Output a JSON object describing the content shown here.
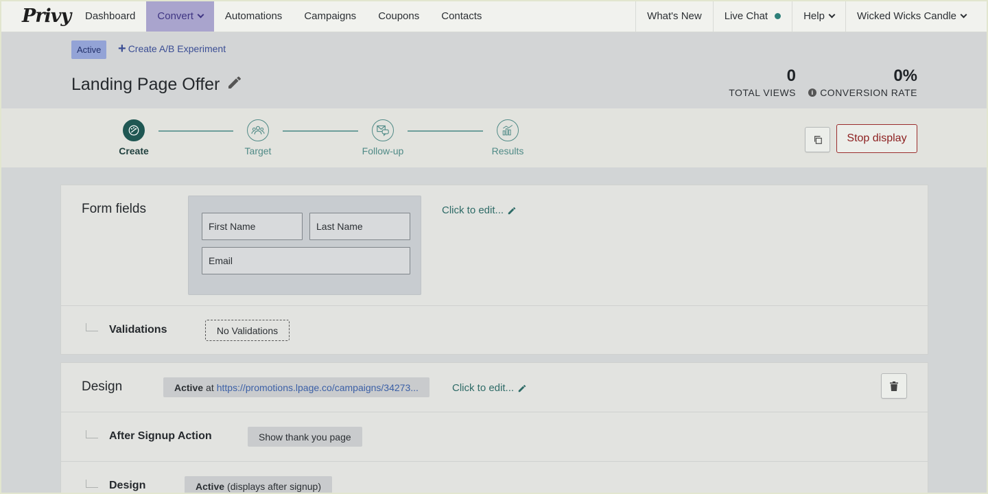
{
  "brand": {
    "logo_text": "Privy"
  },
  "nav": {
    "items": [
      {
        "label": "Dashboard"
      },
      {
        "label": "Convert"
      },
      {
        "label": "Automations"
      },
      {
        "label": "Campaigns"
      },
      {
        "label": "Coupons"
      },
      {
        "label": "Contacts"
      }
    ],
    "right": {
      "whats_new": "What's New",
      "live_chat": "Live Chat",
      "help": "Help",
      "account": "Wicked Wicks Candle"
    }
  },
  "header": {
    "status_badge": "Active",
    "ab_link": "Create A/B Experiment",
    "title": "Landing Page Offer",
    "stats": {
      "total_views": {
        "value": "0",
        "label": "TOTAL VIEWS"
      },
      "conversion_rate": {
        "value": "0%",
        "label": "CONVERSION RATE"
      }
    }
  },
  "steps": [
    {
      "label": "Create",
      "current": true
    },
    {
      "label": "Target",
      "current": false
    },
    {
      "label": "Follow-up",
      "current": false
    },
    {
      "label": "Results",
      "current": false
    }
  ],
  "actions": {
    "stop_display": "Stop display"
  },
  "form_fields": {
    "title": "Form fields",
    "first_name": "First Name",
    "last_name": "Last Name",
    "email": "Email",
    "click_to_edit": "Click to edit...",
    "validations_label": "Validations",
    "validations_value": "No Validations"
  },
  "design": {
    "title": "Design",
    "status": "Active",
    "at": "at",
    "url": "https://promotions.lpage.co/campaigns/34273...",
    "click_to_edit": "Click to edit...",
    "after_signup_label": "After Signup Action",
    "after_signup_value": "Show thank you page",
    "sub_design_label": "Design",
    "sub_design_status": "Active",
    "sub_design_note": "(displays after signup)"
  },
  "colors": {
    "accent_teal": "#1f5753",
    "nav_active_bg": "#a9a4cd",
    "stop_red": "#8c1f1f",
    "badge_blue": "#93a3d6"
  }
}
